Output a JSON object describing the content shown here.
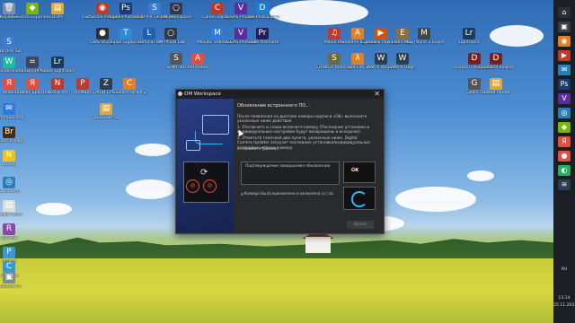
{
  "desktop": {
    "icons": [
      {
        "label": "Корзина",
        "glyph": "🗑",
        "color": "#7b8fa6"
      },
      {
        "label": "GeForce Experience",
        "glyph": "◆",
        "color": "#76b900"
      },
      {
        "label": "stuffs",
        "glyph": "▤",
        "color": "#e0a83a"
      },
      {
        "label": "FastStone Image Viewer",
        "glyph": "◉",
        "color": "#c0392b"
      },
      {
        "label": "Adobe Photoshop",
        "glyph": "Ps",
        "color": "#1c3b6e"
      },
      {
        "label": "SILKYPIX Developer",
        "glyph": "S",
        "color": "#3a7bd5"
      },
      {
        "label": "OM Workspace",
        "glyph": "○",
        "color": "#333a44"
      },
      {
        "label": "Canon Raptors",
        "glyph": "C",
        "color": "#c0392b"
      },
      {
        "label": "VEGAS Pro 19.0",
        "glyph": "V",
        "color": "#5a2ca0"
      },
      {
        "label": "DxO PhotoLab 6",
        "glyph": "D",
        "color": "#1d7fd1"
      },
      {
        "label": "SILKYPIX ISO",
        "glyph": "S",
        "color": "#3a7bd5"
      },
      {
        "label": "OBS Studio",
        "glyph": "●",
        "color": "#302e31"
      },
      {
        "label": "Topaz Gigapixel",
        "glyph": "T",
        "color": "#2b8bd6"
      },
      {
        "label": "Luminar AI",
        "glyph": "L",
        "color": "#1f5fb0"
      },
      {
        "label": "OM Photo Lab",
        "glyph": "○",
        "color": "#333a44"
      },
      {
        "label": "Movavi Video Converter",
        "glyph": "M",
        "color": "#2c7be5"
      },
      {
        "label": "VEGAS Pro 20.0",
        "glyph": "V",
        "color": "#5a2ca0"
      },
      {
        "label": "Adobe Premiere",
        "glyph": "Pr",
        "color": "#2a1b58"
      },
      {
        "label": "Mavie Pro",
        "glyph": "♫",
        "color": "#c0392b"
      },
      {
        "label": "Awesome Capture",
        "glyph": "A",
        "color": "#e67e22"
      },
      {
        "label": "Cyberlink PowerDVD",
        "glyph": "▶",
        "color": "#d35400"
      },
      {
        "label": "Elden Ring",
        "glyph": "E",
        "color": "#8e6e3a"
      },
      {
        "label": "Max Payne 3 Legendary",
        "glyph": "M",
        "color": "#444"
      },
      {
        "label": "Lightroom",
        "glyph": "Lr",
        "color": "#1b3a5c"
      },
      {
        "label": "Wondershare",
        "glyph": "W",
        "color": "#1abc9c"
      },
      {
        "label": "Калькулятор",
        "glyph": "=",
        "color": "#3d4955"
      },
      {
        "label": "Adobe Lightroom",
        "glyph": "Lr",
        "color": "#1b3a5c"
      },
      {
        "label": "SONY Ltd",
        "glyph": "S",
        "color": "#555"
      },
      {
        "label": "AirtimeBR",
        "glyph": "A",
        "color": "#e74c3c"
      },
      {
        "label": "STALKER Anomaly",
        "glyph": "S",
        "color": "#6d6a3c"
      },
      {
        "label": "Half-Life 2",
        "glyph": "λ",
        "color": "#e67e22"
      },
      {
        "label": "Watch Dogs 2",
        "glyph": "W",
        "color": "#2c3e50"
      },
      {
        "label": "Watch Dogs",
        "glyph": "W",
        "color": "#2c3e50"
      },
      {
        "label": "Diablo II Resurrected",
        "glyph": "D",
        "color": "#7b1e1e"
      },
      {
        "label": "Диablo III Reaper",
        "glyph": "D",
        "color": "#7b1e1e"
      },
      {
        "label": "Yandex",
        "glyph": "Я",
        "color": "#e74c3c"
      },
      {
        "label": "Яндекс Браузер",
        "glyph": "Я",
        "color": "#e74c3c"
      },
      {
        "label": "NeXus VR",
        "glyph": "N",
        "color": "#c0392b"
      },
      {
        "label": "ProMaps",
        "glyph": "P",
        "color": "#c0392b"
      },
      {
        "label": "CPUID CPU-Z",
        "glyph": "Z",
        "color": "#2c3e50"
      },
      {
        "label": "Counter-Strike 2",
        "glyph": "C",
        "color": "#e67e22"
      },
      {
        "label": "Gears 5",
        "glyph": "G",
        "color": "#555"
      },
      {
        "label": "Новая папка",
        "glyph": "▤",
        "color": "#e0a83a"
      },
      {
        "label": "Communicator",
        "glyph": "✉",
        "color": "#2c7be5"
      },
      {
        "label": "Документы",
        "glyph": "▤",
        "color": "#e0a83a"
      },
      {
        "label": "Adobe Bridge",
        "glyph": "Br",
        "color": "#4a2a0a"
      },
      {
        "label": "Norton",
        "glyph": "N",
        "color": "#f1c40f"
      },
      {
        "label": "Chromium",
        "glyph": "◎",
        "color": "#2980b9"
      },
      {
        "label": "Новый текст",
        "glyph": "▤",
        "color": "#ddd"
      },
      {
        "label": "WinRAR",
        "glyph": "R",
        "color": "#8e44ad"
      },
      {
        "label": "Photos",
        "glyph": "P",
        "color": "#3498db"
      },
      {
        "label": "Cameras",
        "glyph": "C",
        "color": "#3498db"
      },
      {
        "label": "Корзина ex",
        "glyph": "▣",
        "color": "#7f8c8d"
      }
    ]
  },
  "taskbar": {
    "items": [
      {
        "glyph": "⌂",
        "color": "#2b2f36"
      },
      {
        "glyph": "▣",
        "color": "#3a3f47"
      },
      {
        "glyph": "◉",
        "color": "#e67e22"
      },
      {
        "glyph": "▶",
        "color": "#c0392b"
      },
      {
        "glyph": "✉",
        "color": "#2980b9"
      },
      {
        "glyph": "Ps",
        "color": "#1c3b6e"
      },
      {
        "glyph": "V",
        "color": "#5a2ca0"
      },
      {
        "glyph": "◎",
        "color": "#2980b9"
      },
      {
        "glyph": "◆",
        "color": "#76b900"
      },
      {
        "glyph": "Я",
        "color": "#e74c3c"
      },
      {
        "glyph": "●",
        "color": "#e74c3c"
      },
      {
        "glyph": "◐",
        "color": "#27ae60"
      },
      {
        "glyph": "≋",
        "color": "#2c3e50"
      }
    ],
    "language": "RU",
    "time": "13:14",
    "date": "25.11.2022"
  },
  "dialog": {
    "title": "OM Workspace",
    "close": "✕",
    "heading": "Обновление встроенного ПО...",
    "paragraph1": "После появления на дисплее камеры надписи «OK» выполните указанные ниже действия.",
    "paragraph2": "1. Отключите и снова включите камеру (Последние установки и индивидуальные настройки будут возвращены в исходное).",
    "paragraph3": "2. Отметьте галочкой два пункта, указанные ниже. Digital Camera Updater загрузит последние установки/индивидуальные настройки на вашу камеру.",
    "paragraph4": "3. Нажмите [Далее].",
    "confirm_label": "Подтверждение завершения обновления.",
    "ok_text": "OK",
    "status_text": "Камера была выключена и включена снова.",
    "next_button": "Далее"
  }
}
